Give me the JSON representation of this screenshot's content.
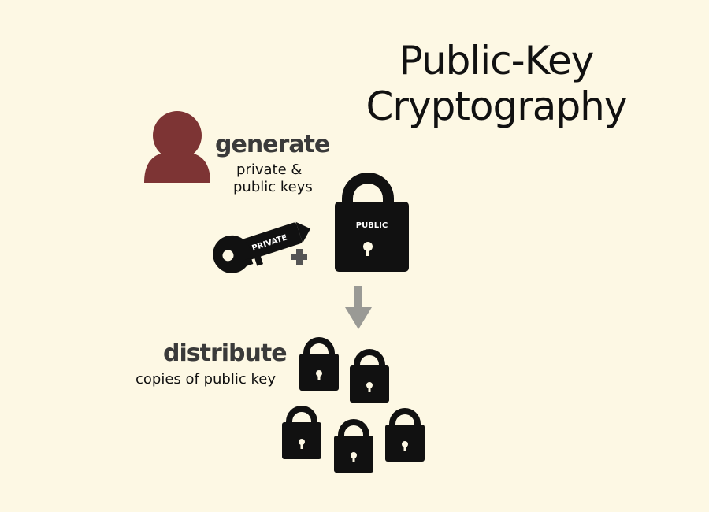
{
  "title": {
    "line1": "Public-Key",
    "line2": "Cryptography"
  },
  "generate": {
    "heading": "generate",
    "line1": "private &",
    "line2": "public keys"
  },
  "key": {
    "label": "PRIVATE"
  },
  "lock": {
    "label": "PUBLIC"
  },
  "distribute": {
    "heading": "distribute",
    "line1": "copies of public key"
  },
  "colors": {
    "background": "#fdf8e4",
    "person": "#7d3434",
    "ink": "#111111",
    "arrow": "#9a9a95",
    "plus": "#555555"
  }
}
